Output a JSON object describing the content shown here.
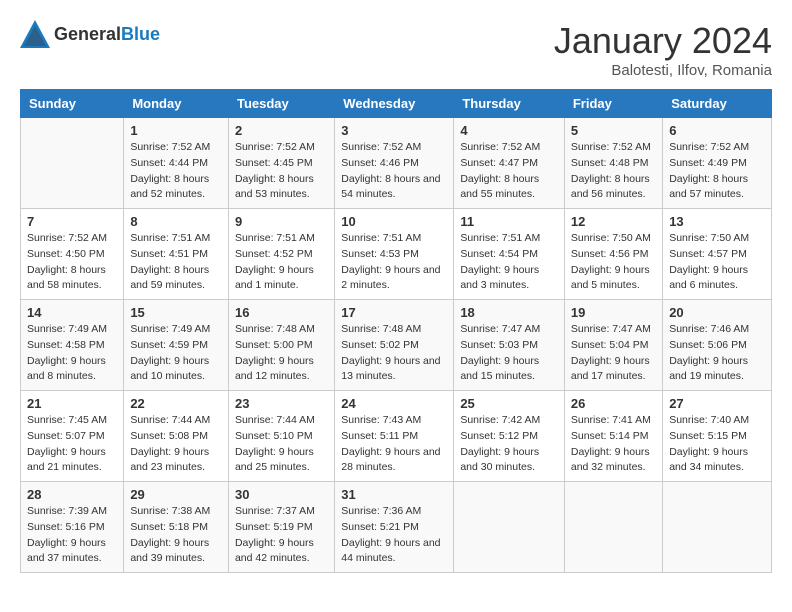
{
  "header": {
    "logo": {
      "text_general": "General",
      "text_blue": "Blue"
    },
    "title": "January 2024",
    "subtitle": "Balotesti, Ilfov, Romania"
  },
  "weekdays": [
    "Sunday",
    "Monday",
    "Tuesday",
    "Wednesday",
    "Thursday",
    "Friday",
    "Saturday"
  ],
  "weeks": [
    [
      null,
      {
        "day": "1",
        "sunrise": "Sunrise: 7:52 AM",
        "sunset": "Sunset: 4:44 PM",
        "daylight": "Daylight: 8 hours and 52 minutes."
      },
      {
        "day": "2",
        "sunrise": "Sunrise: 7:52 AM",
        "sunset": "Sunset: 4:45 PM",
        "daylight": "Daylight: 8 hours and 53 minutes."
      },
      {
        "day": "3",
        "sunrise": "Sunrise: 7:52 AM",
        "sunset": "Sunset: 4:46 PM",
        "daylight": "Daylight: 8 hours and 54 minutes."
      },
      {
        "day": "4",
        "sunrise": "Sunrise: 7:52 AM",
        "sunset": "Sunset: 4:47 PM",
        "daylight": "Daylight: 8 hours and 55 minutes."
      },
      {
        "day": "5",
        "sunrise": "Sunrise: 7:52 AM",
        "sunset": "Sunset: 4:48 PM",
        "daylight": "Daylight: 8 hours and 56 minutes."
      },
      {
        "day": "6",
        "sunrise": "Sunrise: 7:52 AM",
        "sunset": "Sunset: 4:49 PM",
        "daylight": "Daylight: 8 hours and 57 minutes."
      }
    ],
    [
      {
        "day": "7",
        "sunrise": "Sunrise: 7:52 AM",
        "sunset": "Sunset: 4:50 PM",
        "daylight": "Daylight: 8 hours and 58 minutes."
      },
      {
        "day": "8",
        "sunrise": "Sunrise: 7:51 AM",
        "sunset": "Sunset: 4:51 PM",
        "daylight": "Daylight: 8 hours and 59 minutes."
      },
      {
        "day": "9",
        "sunrise": "Sunrise: 7:51 AM",
        "sunset": "Sunset: 4:52 PM",
        "daylight": "Daylight: 9 hours and 1 minute."
      },
      {
        "day": "10",
        "sunrise": "Sunrise: 7:51 AM",
        "sunset": "Sunset: 4:53 PM",
        "daylight": "Daylight: 9 hours and 2 minutes."
      },
      {
        "day": "11",
        "sunrise": "Sunrise: 7:51 AM",
        "sunset": "Sunset: 4:54 PM",
        "daylight": "Daylight: 9 hours and 3 minutes."
      },
      {
        "day": "12",
        "sunrise": "Sunrise: 7:50 AM",
        "sunset": "Sunset: 4:56 PM",
        "daylight": "Daylight: 9 hours and 5 minutes."
      },
      {
        "day": "13",
        "sunrise": "Sunrise: 7:50 AM",
        "sunset": "Sunset: 4:57 PM",
        "daylight": "Daylight: 9 hours and 6 minutes."
      }
    ],
    [
      {
        "day": "14",
        "sunrise": "Sunrise: 7:49 AM",
        "sunset": "Sunset: 4:58 PM",
        "daylight": "Daylight: 9 hours and 8 minutes."
      },
      {
        "day": "15",
        "sunrise": "Sunrise: 7:49 AM",
        "sunset": "Sunset: 4:59 PM",
        "daylight": "Daylight: 9 hours and 10 minutes."
      },
      {
        "day": "16",
        "sunrise": "Sunrise: 7:48 AM",
        "sunset": "Sunset: 5:00 PM",
        "daylight": "Daylight: 9 hours and 12 minutes."
      },
      {
        "day": "17",
        "sunrise": "Sunrise: 7:48 AM",
        "sunset": "Sunset: 5:02 PM",
        "daylight": "Daylight: 9 hours and 13 minutes."
      },
      {
        "day": "18",
        "sunrise": "Sunrise: 7:47 AM",
        "sunset": "Sunset: 5:03 PM",
        "daylight": "Daylight: 9 hours and 15 minutes."
      },
      {
        "day": "19",
        "sunrise": "Sunrise: 7:47 AM",
        "sunset": "Sunset: 5:04 PM",
        "daylight": "Daylight: 9 hours and 17 minutes."
      },
      {
        "day": "20",
        "sunrise": "Sunrise: 7:46 AM",
        "sunset": "Sunset: 5:06 PM",
        "daylight": "Daylight: 9 hours and 19 minutes."
      }
    ],
    [
      {
        "day": "21",
        "sunrise": "Sunrise: 7:45 AM",
        "sunset": "Sunset: 5:07 PM",
        "daylight": "Daylight: 9 hours and 21 minutes."
      },
      {
        "day": "22",
        "sunrise": "Sunrise: 7:44 AM",
        "sunset": "Sunset: 5:08 PM",
        "daylight": "Daylight: 9 hours and 23 minutes."
      },
      {
        "day": "23",
        "sunrise": "Sunrise: 7:44 AM",
        "sunset": "Sunset: 5:10 PM",
        "daylight": "Daylight: 9 hours and 25 minutes."
      },
      {
        "day": "24",
        "sunrise": "Sunrise: 7:43 AM",
        "sunset": "Sunset: 5:11 PM",
        "daylight": "Daylight: 9 hours and 28 minutes."
      },
      {
        "day": "25",
        "sunrise": "Sunrise: 7:42 AM",
        "sunset": "Sunset: 5:12 PM",
        "daylight": "Daylight: 9 hours and 30 minutes."
      },
      {
        "day": "26",
        "sunrise": "Sunrise: 7:41 AM",
        "sunset": "Sunset: 5:14 PM",
        "daylight": "Daylight: 9 hours and 32 minutes."
      },
      {
        "day": "27",
        "sunrise": "Sunrise: 7:40 AM",
        "sunset": "Sunset: 5:15 PM",
        "daylight": "Daylight: 9 hours and 34 minutes."
      }
    ],
    [
      {
        "day": "28",
        "sunrise": "Sunrise: 7:39 AM",
        "sunset": "Sunset: 5:16 PM",
        "daylight": "Daylight: 9 hours and 37 minutes."
      },
      {
        "day": "29",
        "sunrise": "Sunrise: 7:38 AM",
        "sunset": "Sunset: 5:18 PM",
        "daylight": "Daylight: 9 hours and 39 minutes."
      },
      {
        "day": "30",
        "sunrise": "Sunrise: 7:37 AM",
        "sunset": "Sunset: 5:19 PM",
        "daylight": "Daylight: 9 hours and 42 minutes."
      },
      {
        "day": "31",
        "sunrise": "Sunrise: 7:36 AM",
        "sunset": "Sunset: 5:21 PM",
        "daylight": "Daylight: 9 hours and 44 minutes."
      },
      null,
      null,
      null
    ]
  ]
}
